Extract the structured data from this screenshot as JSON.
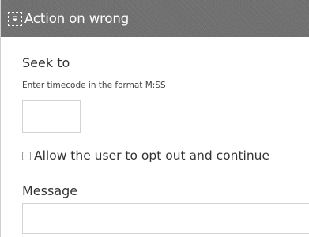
{
  "header": {
    "title": "Action on wrong",
    "collapse_icon": "collapse-chevron-icon"
  },
  "seek": {
    "label": "Seek to",
    "help": "Enter timecode in the format M:SS",
    "value": ""
  },
  "optout": {
    "label": "Allow the user to opt out and continue",
    "checked": false
  },
  "message": {
    "label": "Message",
    "value": ""
  },
  "colors": {
    "header_bg": "#6f6f6f",
    "header_text": "#ffffff",
    "body_text": "#333333",
    "input_border": "#d3d3d3"
  }
}
